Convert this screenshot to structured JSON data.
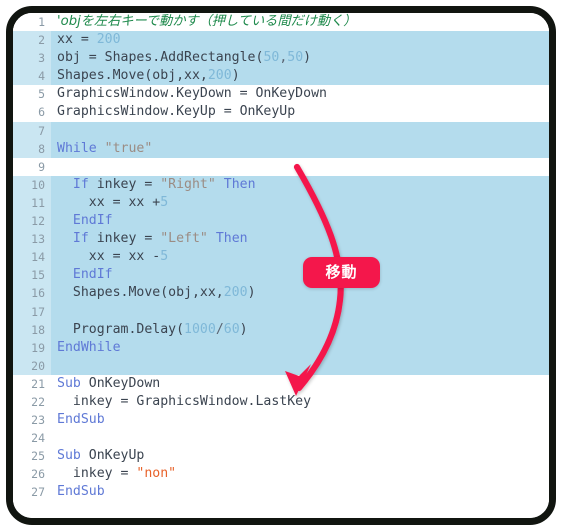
{
  "editor": {
    "language": "Small Basic",
    "gutter_label": "line-numbers",
    "lines": [
      {
        "n": "1",
        "highlight": false,
        "tokens": [
          {
            "t": "cmt",
            "s": "'objを左右キーで動かす（押している間だけ動く）"
          }
        ]
      },
      {
        "n": "2",
        "highlight": true,
        "tokens": [
          {
            "t": "plain",
            "s": "xx = "
          },
          {
            "t": "num",
            "s": "200"
          }
        ]
      },
      {
        "n": "3",
        "highlight": true,
        "tokens": [
          {
            "t": "plain",
            "s": "obj = Shapes.AddRectangle("
          },
          {
            "t": "num",
            "s": "50"
          },
          {
            "t": "op",
            "s": ","
          },
          {
            "t": "num",
            "s": "50"
          },
          {
            "t": "plain",
            "s": ")"
          }
        ]
      },
      {
        "n": "4",
        "highlight": true,
        "tokens": [
          {
            "t": "plain",
            "s": "Shapes.Move(obj,xx,"
          },
          {
            "t": "num",
            "s": "200"
          },
          {
            "t": "plain",
            "s": ")"
          }
        ]
      },
      {
        "n": "5",
        "highlight": false,
        "tokens": [
          {
            "t": "plain",
            "s": "GraphicsWindow.KeyDown = OnKeyDown"
          }
        ]
      },
      {
        "n": "6",
        "highlight": false,
        "tokens": [
          {
            "t": "plain",
            "s": "GraphicsWindow.KeyUp = OnKeyUp"
          }
        ]
      },
      {
        "n": "7",
        "highlight": true,
        "tokens": [
          {
            "t": "plain",
            "s": ""
          }
        ]
      },
      {
        "n": "8",
        "highlight": true,
        "tokens": [
          {
            "t": "kw",
            "s": "While "
          },
          {
            "t": "str",
            "s": "\"true\""
          }
        ]
      },
      {
        "n": "9",
        "highlight": false,
        "tokens": [
          {
            "t": "plain",
            "s": ""
          }
        ]
      },
      {
        "n": "10",
        "highlight": true,
        "tokens": [
          {
            "t": "kw",
            "s": "  If "
          },
          {
            "t": "plain",
            "s": "inkey = "
          },
          {
            "t": "str",
            "s": "\"Right\""
          },
          {
            "t": "kw",
            "s": " Then"
          }
        ]
      },
      {
        "n": "11",
        "highlight": true,
        "tokens": [
          {
            "t": "plain",
            "s": "    xx = xx +"
          },
          {
            "t": "num",
            "s": "5"
          }
        ]
      },
      {
        "n": "12",
        "highlight": true,
        "tokens": [
          {
            "t": "kw",
            "s": "  EndIf"
          }
        ]
      },
      {
        "n": "13",
        "highlight": true,
        "tokens": [
          {
            "t": "kw",
            "s": "  If "
          },
          {
            "t": "plain",
            "s": "inkey = "
          },
          {
            "t": "str",
            "s": "\"Left\""
          },
          {
            "t": "kw",
            "s": " Then"
          }
        ]
      },
      {
        "n": "14",
        "highlight": true,
        "tokens": [
          {
            "t": "plain",
            "s": "    xx = xx -"
          },
          {
            "t": "num",
            "s": "5"
          }
        ]
      },
      {
        "n": "15",
        "highlight": true,
        "tokens": [
          {
            "t": "kw",
            "s": "  EndIf"
          }
        ]
      },
      {
        "n": "16",
        "highlight": true,
        "tokens": [
          {
            "t": "plain",
            "s": "  Shapes.Move(obj,xx,"
          },
          {
            "t": "num",
            "s": "200"
          },
          {
            "t": "plain",
            "s": ")"
          }
        ]
      },
      {
        "n": "17",
        "highlight": true,
        "tokens": [
          {
            "t": "plain",
            "s": ""
          }
        ]
      },
      {
        "n": "18",
        "highlight": true,
        "tokens": [
          {
            "t": "plain",
            "s": "  Program.Delay("
          },
          {
            "t": "num",
            "s": "1000"
          },
          {
            "t": "op",
            "s": "/"
          },
          {
            "t": "num",
            "s": "60"
          },
          {
            "t": "plain",
            "s": ")"
          }
        ]
      },
      {
        "n": "19",
        "highlight": true,
        "tokens": [
          {
            "t": "kw",
            "s": "EndWhile"
          }
        ]
      },
      {
        "n": "20",
        "highlight": true,
        "tokens": [
          {
            "t": "plain",
            "s": ""
          }
        ]
      },
      {
        "n": "21",
        "highlight": false,
        "tokens": [
          {
            "t": "kw",
            "s": "Sub "
          },
          {
            "t": "plain",
            "s": "OnKeyDown"
          }
        ]
      },
      {
        "n": "22",
        "highlight": false,
        "tokens": [
          {
            "t": "plain",
            "s": "  inkey = GraphicsWindow.LastKey"
          }
        ]
      },
      {
        "n": "23",
        "highlight": false,
        "tokens": [
          {
            "t": "kw",
            "s": "EndSub"
          }
        ]
      },
      {
        "n": "24",
        "highlight": false,
        "tokens": [
          {
            "t": "plain",
            "s": ""
          }
        ]
      },
      {
        "n": "25",
        "highlight": false,
        "tokens": [
          {
            "t": "kw",
            "s": "Sub "
          },
          {
            "t": "plain",
            "s": "OnKeyUp"
          }
        ]
      },
      {
        "n": "26",
        "highlight": false,
        "tokens": [
          {
            "t": "plain",
            "s": "  inkey = "
          },
          {
            "t": "str-o",
            "s": "\"non\""
          }
        ]
      },
      {
        "n": "27",
        "highlight": false,
        "tokens": [
          {
            "t": "kw",
            "s": "EndSub"
          }
        ]
      }
    ]
  },
  "annotation": {
    "arrow_name": "curved-arrow-down",
    "badge_label": "移動",
    "accent_color": "#f4174b",
    "highlight_color": "#b4dced",
    "frame_color": "#111510"
  }
}
